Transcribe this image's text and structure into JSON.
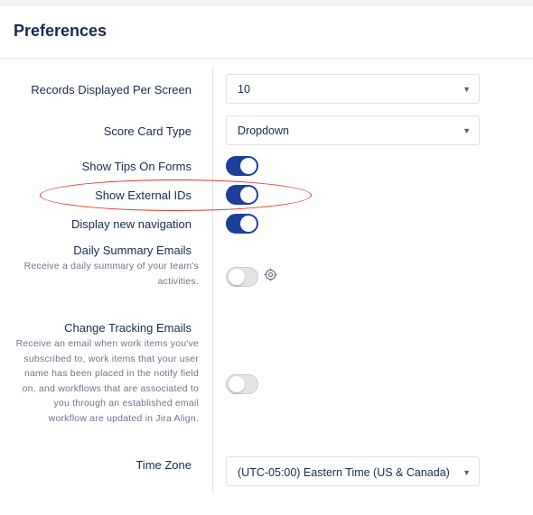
{
  "header": {
    "title": "Preferences"
  },
  "prefs": {
    "records": {
      "label": "Records Displayed Per Screen",
      "value": "10"
    },
    "scorecard": {
      "label": "Score Card Type",
      "value": "Dropdown"
    },
    "tips": {
      "label": "Show Tips On Forms",
      "on": true
    },
    "external_ids": {
      "label": "Show External IDs",
      "on": true
    },
    "new_nav": {
      "label": "Display new navigation",
      "on": true
    },
    "daily": {
      "label": "Daily Summary Emails",
      "desc_lines": [
        "Receive a daily summary of your team's",
        "activities."
      ],
      "on": false
    },
    "change": {
      "label": "Change Tracking Emails",
      "desc_lines": [
        "Receive an email when work items you've",
        "subscribed to, work items that your user",
        "name has been placed in the notify field",
        "on, and workflows that are associated to",
        "you through an established email",
        "workflow are updated in Jira Align."
      ],
      "on": false
    },
    "timezone": {
      "label": "Time Zone",
      "value": "(UTC-05:00) Eastern Time (US & Canada)"
    }
  },
  "icons": {
    "caret": "chevron-down-icon",
    "settings": "settings-icon"
  },
  "colors": {
    "toggle_on": "#1d3f9a",
    "toggle_off": "#e3e4e6",
    "highlight": "#d9362b"
  }
}
